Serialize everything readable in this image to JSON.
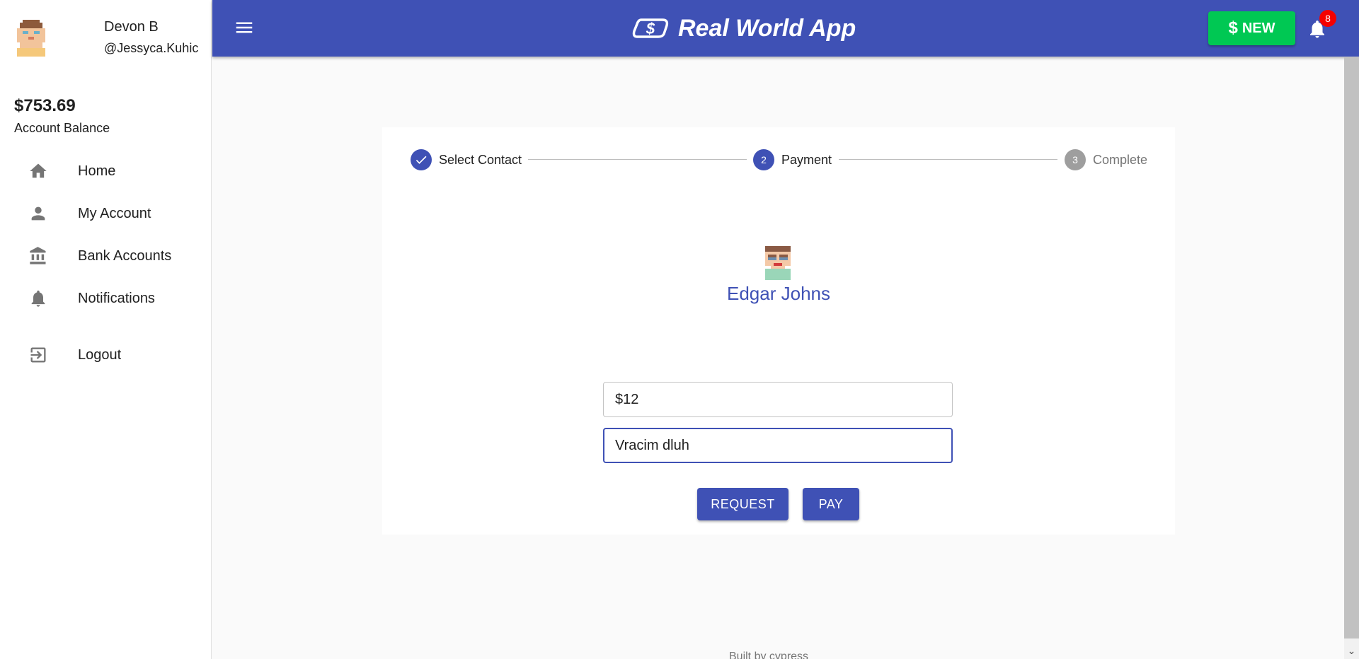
{
  "sidebar": {
    "user": {
      "name": "Devon B",
      "handle": "@Jessyca.Kuhic"
    },
    "balance": {
      "amount": "$753.69",
      "label": "Account Balance"
    },
    "nav": [
      {
        "label": "Home",
        "icon": "home-icon"
      },
      {
        "label": "My Account",
        "icon": "person-icon"
      },
      {
        "label": "Bank Accounts",
        "icon": "bank-icon"
      },
      {
        "label": "Notifications",
        "icon": "bell-icon"
      },
      {
        "label": "Logout",
        "icon": "logout-icon"
      }
    ]
  },
  "topbar": {
    "title": "Real World App",
    "new_label": "NEW",
    "new_icon": "$",
    "notification_count": "8"
  },
  "stepper": {
    "steps": [
      {
        "label": "Select Contact",
        "number": "1",
        "state": "completed"
      },
      {
        "label": "Payment",
        "number": "2",
        "state": "active"
      },
      {
        "label": "Complete",
        "number": "3",
        "state": "inactive"
      }
    ]
  },
  "payment": {
    "contact_name": "Edgar Johns",
    "amount_value": "$12",
    "note_value": "Vracim dluh",
    "request_label": "REQUEST",
    "pay_label": "PAY"
  },
  "footer": {
    "text": "Built by cypress"
  },
  "colors": {
    "primary": "#3f51b5",
    "success": "#00c853",
    "badge": "#f50000"
  }
}
